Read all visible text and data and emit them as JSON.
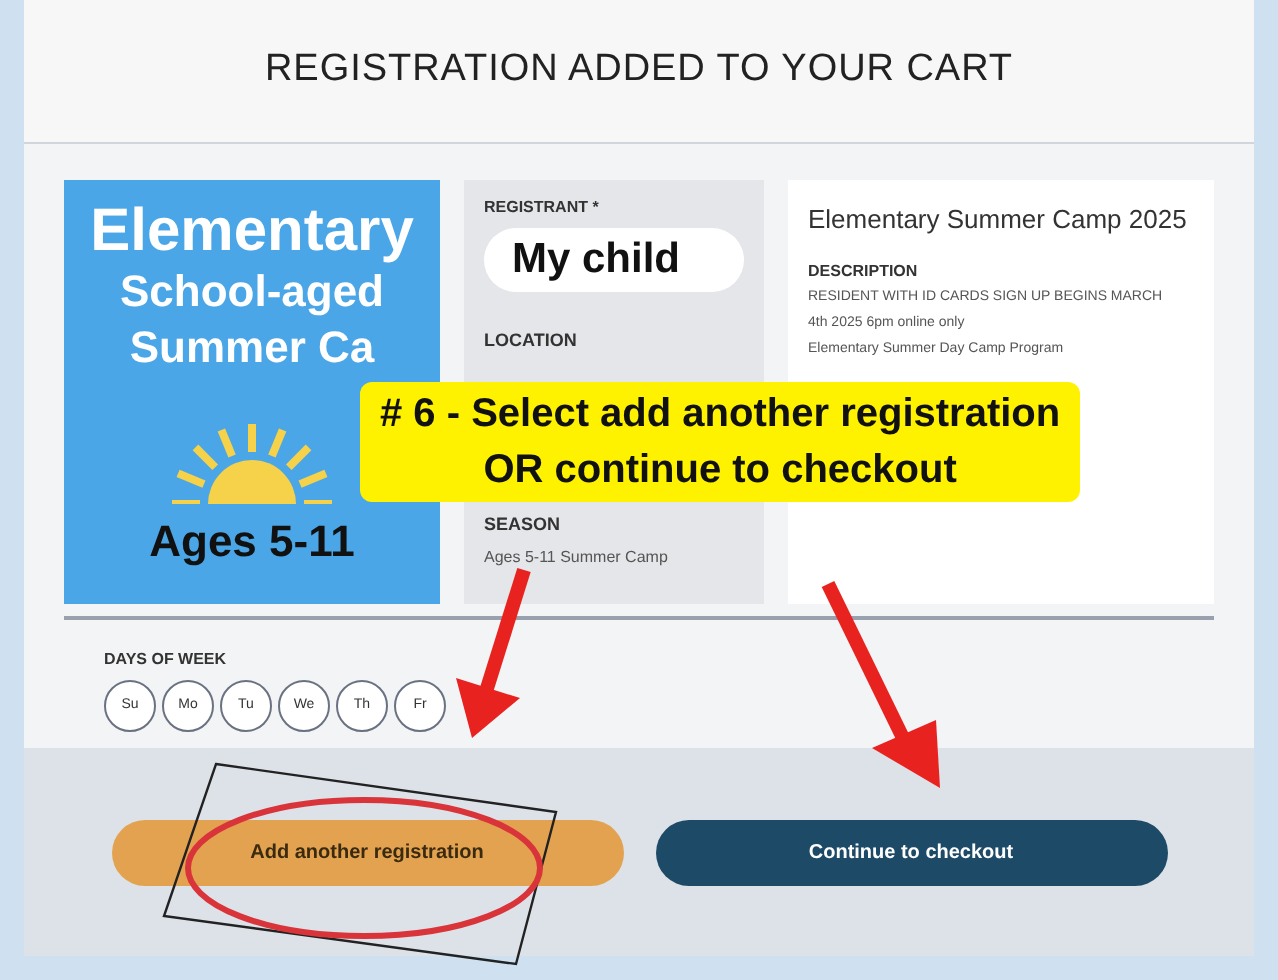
{
  "header": {
    "title": "REGISTRATION ADDED TO YOUR CART"
  },
  "promo_image": {
    "lines": [
      "Elementary",
      "School-aged",
      "Summer Ca"
    ],
    "ages": "Ages 5-11"
  },
  "registrant": {
    "label": "REGISTRANT *",
    "value": "My child"
  },
  "location": {
    "label": "LOCATION"
  },
  "season": {
    "label": "SEASON",
    "value": "Ages 5-11 Summer Camp"
  },
  "program": {
    "title": "Elementary Summer Camp 2025",
    "description_label": "DESCRIPTION",
    "description_lines": [
      "RESIDENT WITH ID CARDS SIGN UP BEGINS MARCH",
      "4th 2025 6pm online only",
      "Elementary Summer Day Camp Program"
    ]
  },
  "days_of_week": {
    "label": "DAYS OF WEEK",
    "days": [
      "Su",
      "Mo",
      "Tu",
      "We",
      "Th",
      "Fr"
    ]
  },
  "buttons": [
    {
      "kind": "secondary",
      "label": "Add another registration"
    },
    {
      "kind": "primary",
      "label": "Continue to checkout"
    }
  ],
  "annotation": {
    "text": "# 6 - Select add another registration",
    "text_line_2": "OR continue to checkout"
  }
}
